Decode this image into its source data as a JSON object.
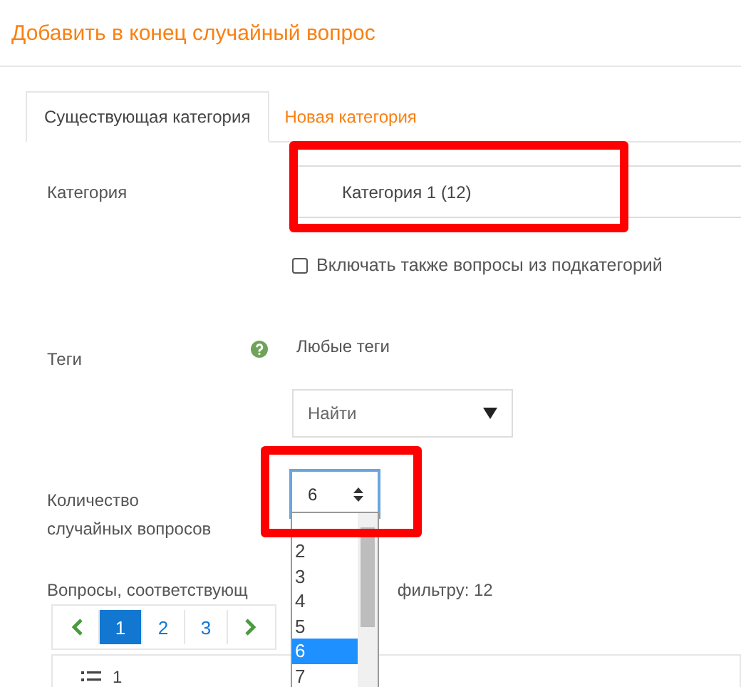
{
  "title": "Добавить в конец случайный вопрос",
  "tabs": [
    {
      "label": "Существующая категория",
      "selected": true
    },
    {
      "label": "Новая категория",
      "selected": false
    }
  ],
  "category": {
    "label": "Категория",
    "value": "Категория 1 (12)"
  },
  "subcategories": {
    "label": "Включать также вопросы из подкатегорий",
    "checked": false
  },
  "tags": {
    "label": "Теги",
    "value": "Любые теги",
    "select": "Найти"
  },
  "count": {
    "label": "Количество случайных вопросов",
    "value": "6",
    "options": [
      {
        "label": "2",
        "selected": false
      },
      {
        "label": "3",
        "selected": false
      },
      {
        "label": "4",
        "selected": false
      },
      {
        "label": "5",
        "selected": false
      },
      {
        "label": "6",
        "selected": true
      },
      {
        "label": "7",
        "selected": false
      }
    ]
  },
  "filter_text": [
    "Вопросы, соответствующ",
    "фильтру: 12"
  ],
  "pagination": [
    {
      "label": "1",
      "selected": true
    },
    {
      "label": "2",
      "selected": false
    },
    {
      "label": "3",
      "selected": false
    }
  ],
  "questions": [
    {
      "number": "1"
    }
  ]
}
